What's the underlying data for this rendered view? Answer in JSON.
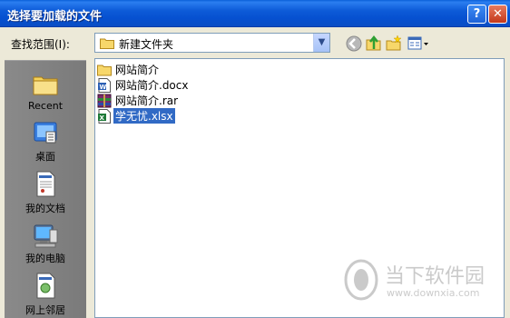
{
  "window": {
    "title": "选择要加载的文件"
  },
  "toolbar": {
    "look_in_label": "查找范围(I):",
    "look_in_value": "新建文件夹"
  },
  "places": [
    {
      "label": "Recent",
      "icon": "recent-folder-icon"
    },
    {
      "label": "桌面",
      "icon": "desktop-icon"
    },
    {
      "label": "我的文档",
      "icon": "my-documents-icon"
    },
    {
      "label": "我的电脑",
      "icon": "my-computer-icon"
    },
    {
      "label": "网上邻居",
      "icon": "network-places-icon"
    }
  ],
  "files": [
    {
      "name": "网站简介",
      "icon": "folder-icon",
      "selected": false
    },
    {
      "name": "网站简介.docx",
      "icon": "word-document-icon",
      "selected": false
    },
    {
      "name": "网站简介.rar",
      "icon": "rar-archive-icon",
      "selected": false
    },
    {
      "name": "学无忧.xlsx",
      "icon": "excel-workbook-icon",
      "selected": true
    }
  ],
  "watermark": {
    "brand": "当下软件园",
    "url": "www.downxia.com"
  },
  "colors": {
    "titlebar": "#0a5fd8",
    "selection": "#316ac5",
    "dialog_bg": "#ece9d8",
    "places_bg": "#7a7a7a"
  }
}
